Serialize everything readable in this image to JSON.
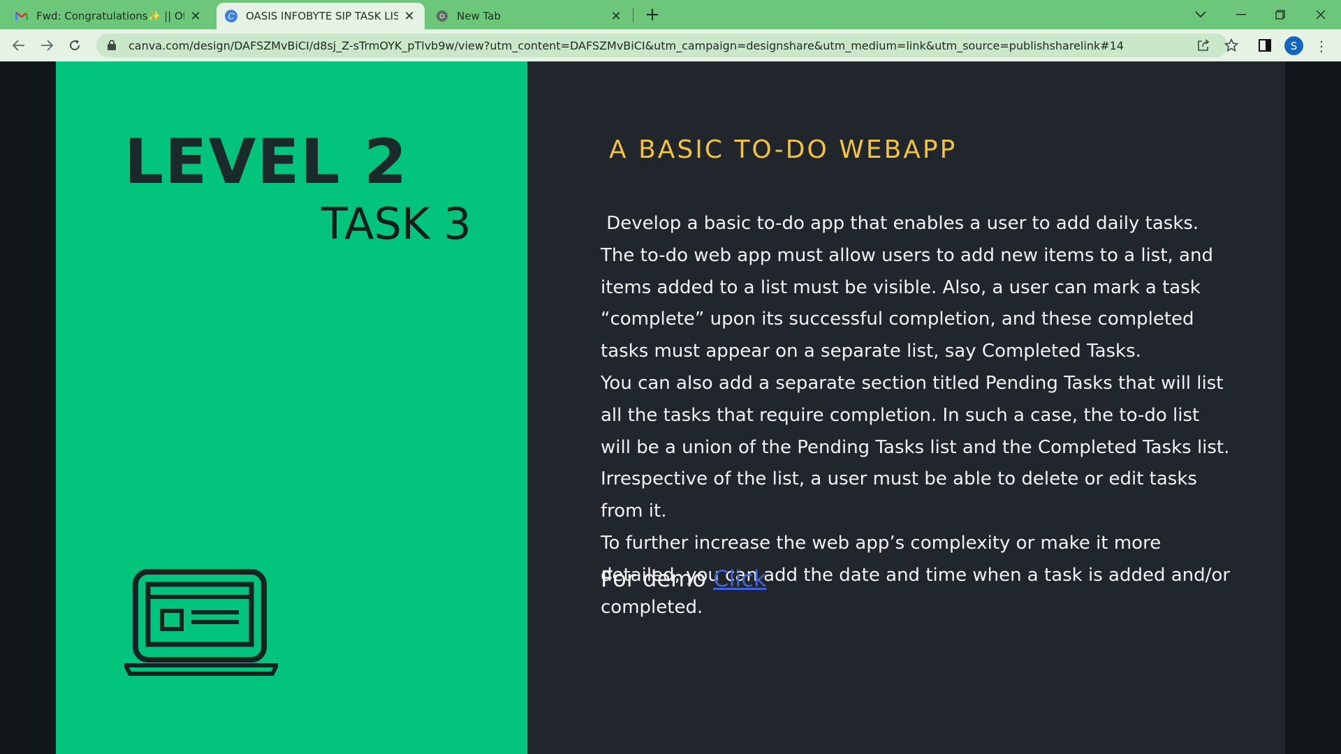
{
  "browser": {
    "tabs": [
      {
        "title": "Fwd: Congratulations✨ || Offer L",
        "icon": "gmail-icon",
        "active": false
      },
      {
        "title": "OASIS INFOBYTE SIP TASK LIST",
        "icon": "canva-icon",
        "active": true
      },
      {
        "title": "New Tab",
        "icon": "chrome-icon",
        "active": false
      }
    ],
    "new_tab_label": "+",
    "url": "canva.com/design/DAFSZMvBiCI/d8sj_Z-sTrmOYK_pTlvb9w/view?utm_content=DAFSZMvBiCI&utm_campaign=designshare&utm_medium=link&utm_source=publishsharelink#14",
    "profile_initial": "S",
    "accent_color": "#6dc77a"
  },
  "slide": {
    "level": "LEVEL 2",
    "task": "TASK 3",
    "heading": "A BASIC TO-DO WEBAPP",
    "paragraphs": [
      " Develop a basic to-do app that enables a user to add daily tasks.",
      "The to-do web app must allow users to add new items to a list, and items added to a list must be visible. Also, a user can mark a task “complete” upon its successful completion, and these completed tasks must appear on a separate list, say Completed Tasks.",
      "You can also add a separate section titled Pending Tasks that will list all the tasks that require completion. In such a case, the to-do list will be a union of the Pending Tasks list and the Completed Tasks list. Irrespective of the list, a user must be able to delete or edit tasks from it.",
      "To further increase the web app’s complexity or make it more detailed, you can add the date and time when a task is added and/or completed."
    ],
    "demo_prefix": "For demo ",
    "demo_link": "Click",
    "colors": {
      "left_panel": "#03c47d",
      "right_panel": "#21262c",
      "heading": "#f3c33c",
      "link": "#4364d6"
    }
  }
}
